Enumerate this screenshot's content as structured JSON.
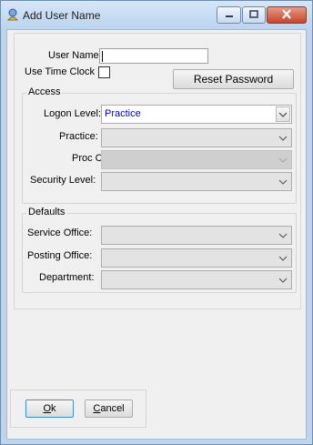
{
  "window": {
    "title": "Add User Name"
  },
  "form": {
    "user_name_label": "User Name",
    "user_name_value": "",
    "use_time_clock_label": "Use Time Clock",
    "use_time_clock_checked": false,
    "reset_password_label": "Reset Password"
  },
  "access": {
    "group_title": "Access",
    "logon_level_label": "Logon Level:",
    "logon_level_value": "Practice",
    "practice_label": "Practice:",
    "proc_ctr_label": "Proc Ctr:",
    "security_level_label": "Security Level:"
  },
  "defaults": {
    "group_title": "Defaults",
    "service_office_label": "Service Office:",
    "posting_office_label": "Posting Office:",
    "department_label": "Department:"
  },
  "buttons": {
    "ok_mnemonic": "O",
    "ok_rest": "k",
    "cancel_mnemonic": "C",
    "cancel_rest": "ancel"
  }
}
